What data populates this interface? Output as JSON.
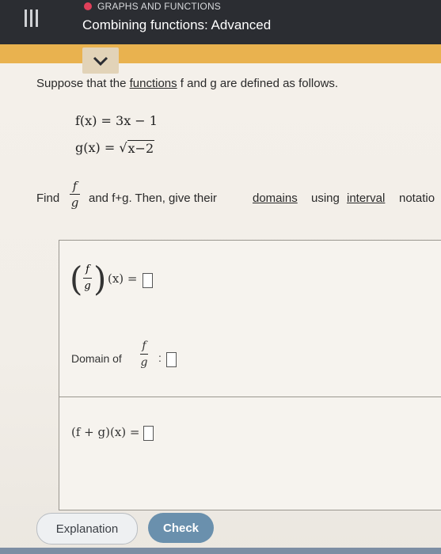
{
  "header": {
    "topic": "GRAPHS AND FUNCTIONS",
    "title": "Combining functions: Advanced",
    "icons": [
      "menu-icon",
      "chevron-down-icon"
    ]
  },
  "question": {
    "intro_1": "Suppose that the ",
    "intro_link": "functions",
    "intro_2": " f and g are defined as follows.",
    "f_def": "f(x) = 3x − 1",
    "g_lhs": "g(x) = ",
    "g_radicand": "x−2",
    "find_word": "Find",
    "find_num": "f",
    "find_den": "g",
    "find_mid": "and f+g. Then, give their",
    "domains_link": "domains",
    "find_using": "using",
    "interval_link": "interval",
    "find_tail": "notatio"
  },
  "answers": {
    "quotient_num": "f",
    "quotient_den": "g",
    "quotient_arg": "(x) =",
    "domain_label": "Domain of",
    "domain_colon": ":",
    "sum_label": "(f + g)(x) ="
  },
  "buttons": {
    "explanation": "Explanation",
    "check": "Check"
  },
  "colors": {
    "header_bg": "#2b2d32",
    "accent_amber": "#e9b24f",
    "topic_dot": "#e0405a",
    "check_button": "#6a90ad"
  }
}
